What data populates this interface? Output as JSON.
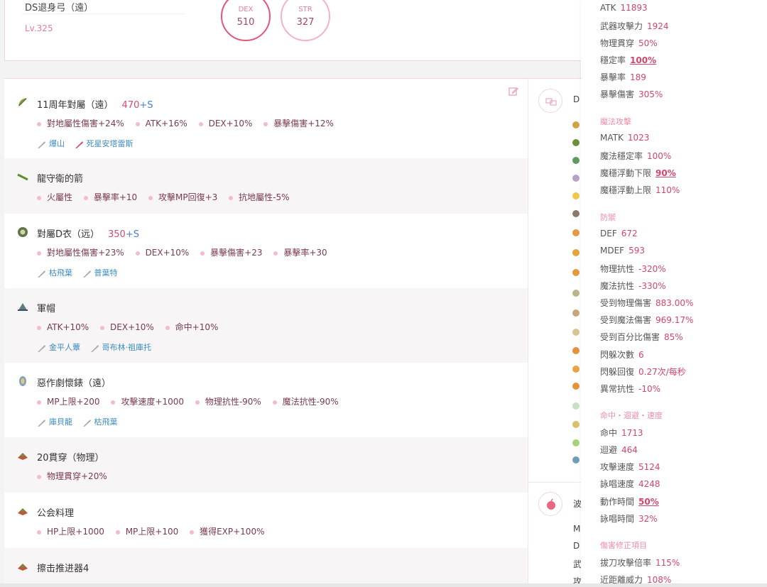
{
  "character": {
    "name": "DS退身弓（遠）",
    "level": "Lv.325",
    "stats": [
      {
        "label": "DEX",
        "value": "510"
      },
      {
        "label": "STR",
        "value": "327"
      }
    ]
  },
  "equipment": [
    {
      "title": "11周年對屬（遠）",
      "level": "470",
      "plus": "+S",
      "stats": [
        "對地屬性傷害+24%",
        "ATK+16%",
        "DEX+10%",
        "暴擊傷害+12%"
      ],
      "crystals": [
        "爆山",
        "死星安塔雷斯"
      ]
    },
    {
      "title": "龍守衛的箭",
      "level": "",
      "plus": "",
      "stats": [
        "火屬性",
        "暴擊率+10",
        "攻擊MP回復+3",
        "抗地屬性-5%"
      ],
      "crystals": []
    },
    {
      "title": "對屬D衣（远）",
      "level": "350",
      "plus": "+S",
      "stats": [
        "對地屬性傷害+23%",
        "DEX+10%",
        "暴擊傷害+23",
        "暴擊率+30"
      ],
      "crystals": [
        "枯飛葉",
        "普葉特"
      ]
    },
    {
      "title": "軍帽",
      "level": "",
      "plus": "",
      "stats": [
        "ATK+10%",
        "DEX+10%",
        "命中+10%"
      ],
      "crystals": [
        "金平人蕈",
        "哥布林·祖庫托"
      ]
    },
    {
      "title": "惡作劇懷錶（遠）",
      "level": "",
      "plus": "",
      "stats": [
        "MP上限+200",
        "攻擊速度+1000",
        "物理抗性-90%",
        "魔法抗性-90%"
      ],
      "crystals": [
        "庫貝龍",
        "枯飛葉"
      ]
    },
    {
      "title": "20貫穿（物理）",
      "level": "",
      "plus": "",
      "stats": [
        "物理貫穿+20%"
      ],
      "crystals": []
    },
    {
      "title": "公会料理",
      "level": "",
      "plus": "",
      "stats": [
        "HP上限+1000",
        "MP上限+100",
        "獲得EXP+100%"
      ],
      "crystals": []
    },
    {
      "title": "擦击推进器4",
      "level": "",
      "plus": "",
      "stats": [],
      "crystals": []
    }
  ],
  "middle": {
    "letters": [
      "D",
      "M",
      "D",
      "武",
      "攻",
      "波"
    ]
  },
  "status_panel": {
    "atk_group": [
      {
        "label": "ATK",
        "value": "11893"
      },
      {
        "label": "武器攻擊力",
        "value": "1924"
      },
      {
        "label": "物理貫穿",
        "value": "50%"
      },
      {
        "label": "穩定率",
        "value": "100%"
      },
      {
        "label": "暴擊率",
        "value": "189"
      },
      {
        "label": "暴擊傷害",
        "value": "305%"
      }
    ],
    "magic_title": "魔法攻擊",
    "magic_group": [
      {
        "label": "MATK",
        "value": "1023"
      },
      {
        "label": "魔法穩定率",
        "value": "100%"
      },
      {
        "label": "魔穩浮動下限",
        "value": "90%"
      },
      {
        "label": "魔穩浮動上限",
        "value": "110%"
      }
    ],
    "defense_title": "防禦",
    "defense_group": [
      {
        "label": "DEF",
        "value": "672"
      },
      {
        "label": "MDEF",
        "value": "593"
      },
      {
        "label": "物理抗性",
        "value": "-320%"
      },
      {
        "label": "魔法抗性",
        "value": "-330%"
      },
      {
        "label": "受到物理傷害",
        "value": "883.00%"
      },
      {
        "label": "受到魔法傷害",
        "value": "969.17%"
      },
      {
        "label": "受到百分比傷害",
        "value": "85%"
      },
      {
        "label": "閃躲次數",
        "value": "6"
      },
      {
        "label": "閃躲回復",
        "value": "0.27次/每秒"
      },
      {
        "label": "異常抗性",
        "value": "-10%"
      }
    ],
    "hit_title": "命中・迴避・速度",
    "hit_group": [
      {
        "label": "命中",
        "value": "1713"
      },
      {
        "label": "迴避",
        "value": "464"
      },
      {
        "label": "攻擊速度",
        "value": "5124"
      },
      {
        "label": "詠唱速度",
        "value": "4248"
      },
      {
        "label": "動作時間",
        "value": "50%"
      },
      {
        "label": "詠唱時間",
        "value": "32%"
      }
    ],
    "dmg_title": "傷害修正項目",
    "dmg_group": [
      {
        "label": "拔刀攻擊倍率",
        "value": "115%"
      },
      {
        "label": "近距離威力",
        "value": "108%"
      }
    ]
  }
}
